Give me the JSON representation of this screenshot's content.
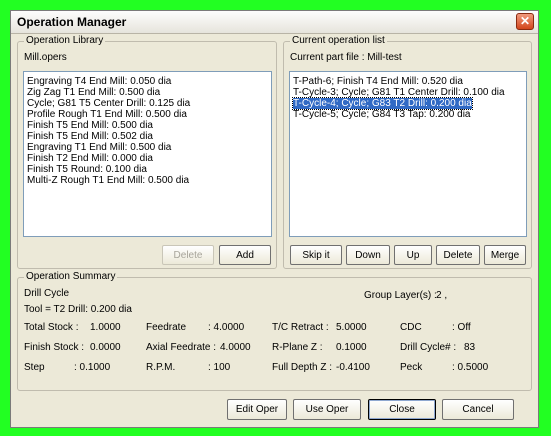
{
  "window": {
    "title": "Operation Manager"
  },
  "library": {
    "legend": "Operation Library",
    "filename": "Mill.opers",
    "items": [
      "Engraving T4  End Mill: 0.050 dia",
      "Zig Zag T1  End Mill: 0.500 dia",
      "Cycle; G81 T5  Center Drill: 0.125 dia",
      "Profile Rough T1  End Mill: 0.500 dia",
      "Finish T5  End Mill: 0.500 dia",
      "Finish T5  End Mill: 0.502 dia",
      "Engraving T1  End Mill: 0.500 dia",
      "Finish T2  End Mill: 0.000 dia",
      "Finish T5  Round: 0.100 dia",
      "Multi-Z Rough T1  End Mill: 0.500 dia"
    ],
    "delete_label": "Delete",
    "add_label": "Add"
  },
  "current": {
    "legend": "Current operation list",
    "partfile": "Current part file : Mill-test",
    "items": [
      "T-Path-6; Finish T4  End Mill: 0.520 dia",
      "T-Cycle-3; Cycle; G81 T1  Center Drill: 0.100 dia",
      "T-Cycle-4; Cycle; G83 T2  Drill: 0.200 dia",
      "T-Cycle-5; Cycle; G84 T3  Tap: 0.200 dia"
    ],
    "selected_index": 2,
    "skip_label": "Skip it",
    "down_label": "Down",
    "up_label": "Up",
    "delete_label": "Delete",
    "merge_label": "Merge"
  },
  "summary": {
    "legend": "Operation Summary",
    "cycle": "Drill Cycle",
    "group_label": "Group Layer(s) :",
    "group_value": "2 ,",
    "tool": "Tool = T2  Drill: 0.200 dia",
    "total_stock_label": "Total Stock  :",
    "total_stock_value": "1.0000",
    "feedrate_label": "Feedrate",
    "feedrate_value": ":  4.0000",
    "tc_retract_label": "T/C Retract  :",
    "tc_retract_value": "5.0000",
    "cdc_label": "CDC",
    "cdc_value": ":   Off",
    "finish_stock_label": "Finish Stock :",
    "finish_stock_value": "0.0000",
    "axial_feedrate_label": "Axial Feedrate :",
    "axial_feedrate_value": "4.0000",
    "rplane_label": "R-Plane Z   :",
    "rplane_value": "0.1000",
    "drill_cycle_label": "Drill Cycle# :",
    "drill_cycle_value": "83",
    "step_label": "Step",
    "step_value": ":  0.1000",
    "rpm_label": "R.P.M.",
    "rpm_value": ":    100",
    "full_depth_label": "Full Depth Z :",
    "full_depth_value": "-0.4100",
    "peck_label": "Peck",
    "peck_value": ":   0.5000"
  },
  "footer": {
    "edit_label": "Edit Oper",
    "use_label": "Use Oper",
    "close_label": "Close",
    "cancel_label": "Cancel"
  }
}
